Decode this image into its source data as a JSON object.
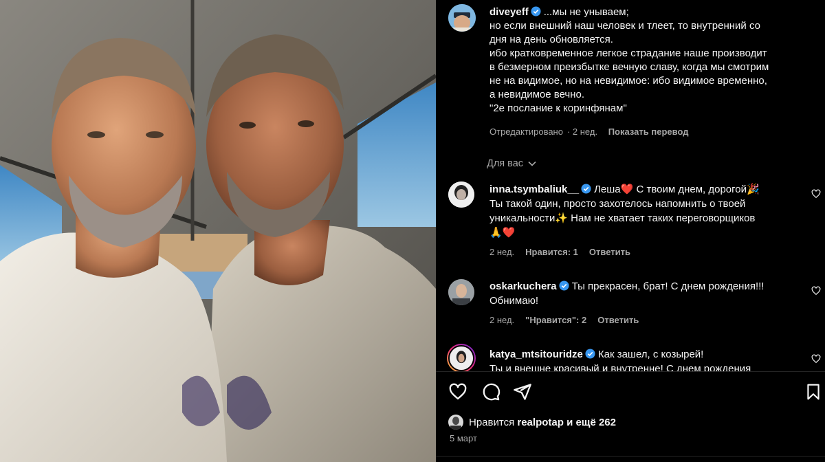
{
  "post": {
    "author": "diveyeff",
    "caption_lines": [
      "...мы не унываем;",
      "но если внешний наш человек и тлеет, то внутренний со",
      "дня на день обновляется.",
      "ибо кратковременное легкое страдание наше производит",
      "в безмерном преизбытке вечную славу, когда мы смотрим",
      "не на видимое, но на невидимое: ибо видимое временно,",
      "а невидимое вечно.",
      "\"2е послание к коринфянам\""
    ],
    "edited_label": "Отредактировано",
    "edited_time": "· 2 нед.",
    "translate_label": "Показать перевод"
  },
  "filter": {
    "label": "Для вас"
  },
  "comments": [
    {
      "username": "inna.tsymbaliuk__",
      "lines": [
        "Леша❤️ С твоим днем, дорогой🎉",
        "Ты такой один, просто захотелось напомнить о твоей",
        "уникальности✨ Нам не хватает таких переговорщиков",
        "🙏❤️"
      ],
      "time": "2 нед.",
      "likes": "Нравится: 1",
      "reply": "Ответить"
    },
    {
      "username": "oskarkuchera",
      "lines": [
        "Ты прекрасен, брат! С днем рождения!!!",
        "Обнимаю!"
      ],
      "time": "2 нед.",
      "likes": "\"Нравится\": 2",
      "reply": "Ответить"
    },
    {
      "username": "katya_mtsitouridze",
      "lines": [
        "Как зашел, с козырей!",
        "Ты и внешне красивый и внутренне! С днем рождения"
      ]
    }
  ],
  "likes_bar": {
    "prefix": "Нравится",
    "user": "realpotap",
    "suffix": "и ещё 262"
  },
  "date": "5 март",
  "icons": {
    "verified": "verified-badge-icon",
    "like": "heart-icon",
    "comment": "comment-bubble-icon",
    "share": "paper-plane-icon",
    "save": "bookmark-icon"
  },
  "colors": {
    "background": "#000000",
    "text": "#f5f5f5",
    "muted": "#a8a8a8",
    "verified": "#3897f0",
    "heart": "#ed4956"
  }
}
